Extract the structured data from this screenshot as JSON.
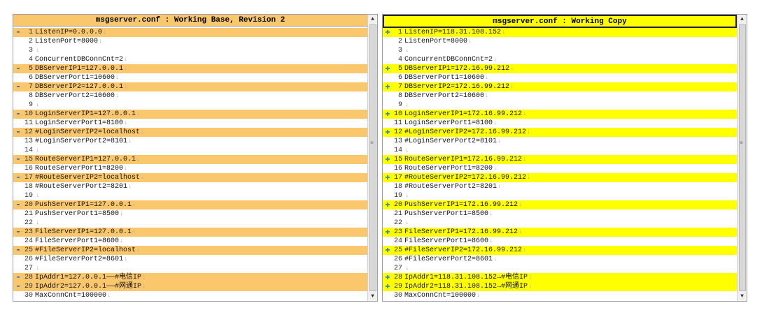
{
  "left_pane": {
    "title": "msgserver.conf : Working Base, Revision 2",
    "lines": [
      {
        "n": "1",
        "t": "ListenIP=0.0.0.0",
        "c": true
      },
      {
        "n": "2",
        "t": "ListenPort=8000",
        "c": false
      },
      {
        "n": "3",
        "t": "",
        "c": false
      },
      {
        "n": "4",
        "t": "ConcurrentDBConnCnt=2",
        "c": false
      },
      {
        "n": "5",
        "t": "DBServerIP1=127.0.0.1",
        "c": true
      },
      {
        "n": "6",
        "t": "DBServerPort1=10600",
        "c": false
      },
      {
        "n": "7",
        "t": "DBServerIP2=127.0.0.1",
        "c": true
      },
      {
        "n": "8",
        "t": "DBServerPort2=10600",
        "c": false
      },
      {
        "n": "9",
        "t": "",
        "c": false
      },
      {
        "n": "10",
        "t": "LoginServerIP1=127.0.0.1",
        "c": true
      },
      {
        "n": "11",
        "t": "LoginServerPort1=8100",
        "c": false
      },
      {
        "n": "12",
        "t": "#LoginServerIP2=localhost",
        "c": true
      },
      {
        "n": "13",
        "t": "#LoginServerPort2=8101",
        "c": false
      },
      {
        "n": "14",
        "t": "",
        "c": false
      },
      {
        "n": "15",
        "t": "RouteServerIP1=127.0.0.1",
        "c": true
      },
      {
        "n": "16",
        "t": "RouteServerPort1=8200",
        "c": false
      },
      {
        "n": "17",
        "t": "#RouteServerIP2=localhost",
        "c": true
      },
      {
        "n": "18",
        "t": "#RouteServerPort2=8201",
        "c": false
      },
      {
        "n": "19",
        "t": "",
        "c": false
      },
      {
        "n": "20",
        "t": "PushServerIP1=127.0.0.1",
        "c": true
      },
      {
        "n": "21",
        "t": "PushServerPort1=8500",
        "c": false
      },
      {
        "n": "22",
        "t": "",
        "c": false
      },
      {
        "n": "23",
        "t": "FileServerIP1=127.0.0.1",
        "c": true
      },
      {
        "n": "24",
        "t": "FileServerPort1=8600",
        "c": false
      },
      {
        "n": "25",
        "t": "#FileServerIP2=localhost",
        "c": true
      },
      {
        "n": "26",
        "t": "#FileServerPort2=8601",
        "c": false
      },
      {
        "n": "27",
        "t": "",
        "c": false
      },
      {
        "n": "28",
        "t": "IpAddr1=127.0.0.1——#电信IP",
        "c": true
      },
      {
        "n": "29",
        "t": "IpAddr2=127.0.0.1——#网通IP",
        "c": true
      },
      {
        "n": "30",
        "t": "MaxConnCnt=100000",
        "c": false
      }
    ]
  },
  "right_pane": {
    "title": "msgserver.conf : Working Copy",
    "lines": [
      {
        "n": "1",
        "t": "ListenIP=118.31.108.152",
        "c": true
      },
      {
        "n": "2",
        "t": "ListenPort=8000",
        "c": false
      },
      {
        "n": "3",
        "t": "",
        "c": false
      },
      {
        "n": "4",
        "t": "ConcurrentDBConnCnt=2",
        "c": false
      },
      {
        "n": "5",
        "t": "DBServerIP1=172.16.99.212",
        "c": true
      },
      {
        "n": "6",
        "t": "DBServerPort1=10600",
        "c": false
      },
      {
        "n": "7",
        "t": "DBServerIP2=172.16.99.212",
        "c": true
      },
      {
        "n": "8",
        "t": "DBServerPort2=10600",
        "c": false
      },
      {
        "n": "9",
        "t": "",
        "c": false
      },
      {
        "n": "10",
        "t": "LoginServerIP1=172.16.99.212",
        "c": true
      },
      {
        "n": "11",
        "t": "LoginServerPort1=8100",
        "c": false
      },
      {
        "n": "12",
        "t": "#LoginServerIP2=172.16.99.212",
        "c": true
      },
      {
        "n": "13",
        "t": "#LoginServerPort2=8101",
        "c": false
      },
      {
        "n": "14",
        "t": "",
        "c": false
      },
      {
        "n": "15",
        "t": "RouteServerIP1=172.16.99.212",
        "c": true
      },
      {
        "n": "16",
        "t": "RouteServerPort1=8200",
        "c": false
      },
      {
        "n": "17",
        "t": "#RouteServerIP2=172.16.99.212",
        "c": true
      },
      {
        "n": "18",
        "t": "#RouteServerPort2=8201",
        "c": false
      },
      {
        "n": "19",
        "t": "",
        "c": false
      },
      {
        "n": "20",
        "t": "PushServerIP1=172.16.99.212",
        "c": true
      },
      {
        "n": "21",
        "t": "PushServerPort1=8500",
        "c": false
      },
      {
        "n": "22",
        "t": "",
        "c": false
      },
      {
        "n": "23",
        "t": "FileServerIP1=172.16.99.212",
        "c": true
      },
      {
        "n": "24",
        "t": "FileServerPort1=8600",
        "c": false
      },
      {
        "n": "25",
        "t": "#FileServerIP2=172.16.99.212",
        "c": true
      },
      {
        "n": "26",
        "t": "#FileServerPort2=8601",
        "c": false
      },
      {
        "n": "27",
        "t": "",
        "c": false
      },
      {
        "n": "28",
        "t": "IpAddr1=118.31.108.152→#电信IP",
        "c": true
      },
      {
        "n": "29",
        "t": "IpAddr2=118.31.108.152→#网通IP",
        "c": true
      },
      {
        "n": "30",
        "t": "MaxConnCnt=100000",
        "c": false
      }
    ]
  },
  "icons": {
    "removed": "minus-marker",
    "added": "plus-marker",
    "eol": "line-end-arrow"
  },
  "colors": {
    "left_changed": "#fbc76c",
    "right_changed": "#ffff00"
  }
}
